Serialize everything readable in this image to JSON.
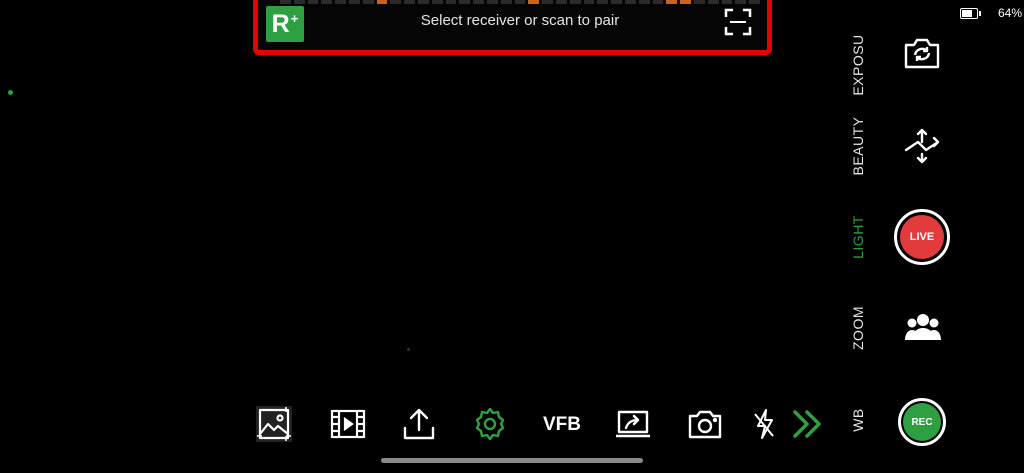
{
  "top_bar": {
    "logo_text": "R",
    "logo_super": "+",
    "message": "Select receiver or scan to pair"
  },
  "status": {
    "battery_percent": "64%",
    "battery_level": 0.64
  },
  "side_menu": {
    "items": [
      {
        "label": "EXPOSU",
        "active": false
      },
      {
        "label": "BEAUTY",
        "active": false
      },
      {
        "label": "LIGHT",
        "active": true
      },
      {
        "label": "ZOOM",
        "active": false
      },
      {
        "label": "WB",
        "active": false
      }
    ]
  },
  "controls": {
    "live_label": "LIVE",
    "rec_label": "REC"
  },
  "toolbar": {
    "vfb_label": "VFB"
  },
  "colors": {
    "accent_green": "#2ea043",
    "live_red": "#e23b3b",
    "highlight_red": "#e60000"
  },
  "icons": [
    "scan-icon",
    "camera-switch-icon",
    "flip-arrows-icon",
    "people-icon",
    "gallery-icon",
    "film-icon",
    "upload-icon",
    "settings-icon",
    "screen-share-icon",
    "camera-icon",
    "flash-off-icon",
    "double-chevron-right-icon"
  ]
}
